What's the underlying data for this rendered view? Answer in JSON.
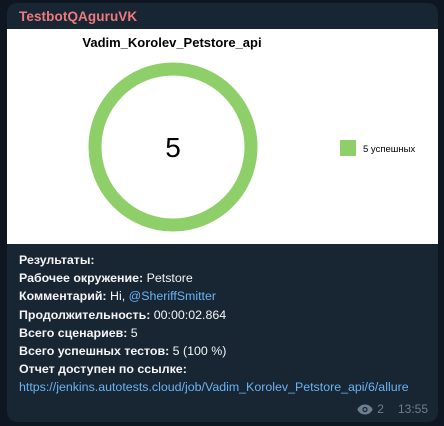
{
  "message": {
    "sender": "TestbotQAguruVK",
    "lines": {
      "results": "Результаты:",
      "env_label": "Рабочее окружение:",
      "env_value": " Petstore",
      "comment_label": "Комментарий:",
      "comment_prefix": " Hi, ",
      "comment_mention": "@SheriffSmitter",
      "duration_label": "Продолжительность:",
      "duration_value": " 00:00:02.864",
      "total_label": "Всего сценариев:",
      "total_value": " 5",
      "passed_label": "Всего успешных тестов:",
      "passed_value": " 5 (100 %)",
      "report_label": "Отчет доступен по ссылке:",
      "report_url": "https://jenkins.autotests.cloud/job/Vadim_Korolev_Petstore_api/6/allure"
    },
    "views": "2",
    "time": "13:55"
  },
  "icons": [
    "eye-icon"
  ],
  "colors": {
    "chat_bg": "#0e1621",
    "bubble_bg": "#182533",
    "sender": "#ee7a7f",
    "link": "#6ab3f3",
    "donut_green": "#8fcf6a"
  },
  "chart_data": {
    "type": "pie",
    "title": "Vadim_Korolev_Petstore_api",
    "center_label": "5",
    "legend_position": "right",
    "slices": [
      {
        "name": "5 успешных",
        "value": 5,
        "color": "#8fcf6a"
      }
    ]
  }
}
